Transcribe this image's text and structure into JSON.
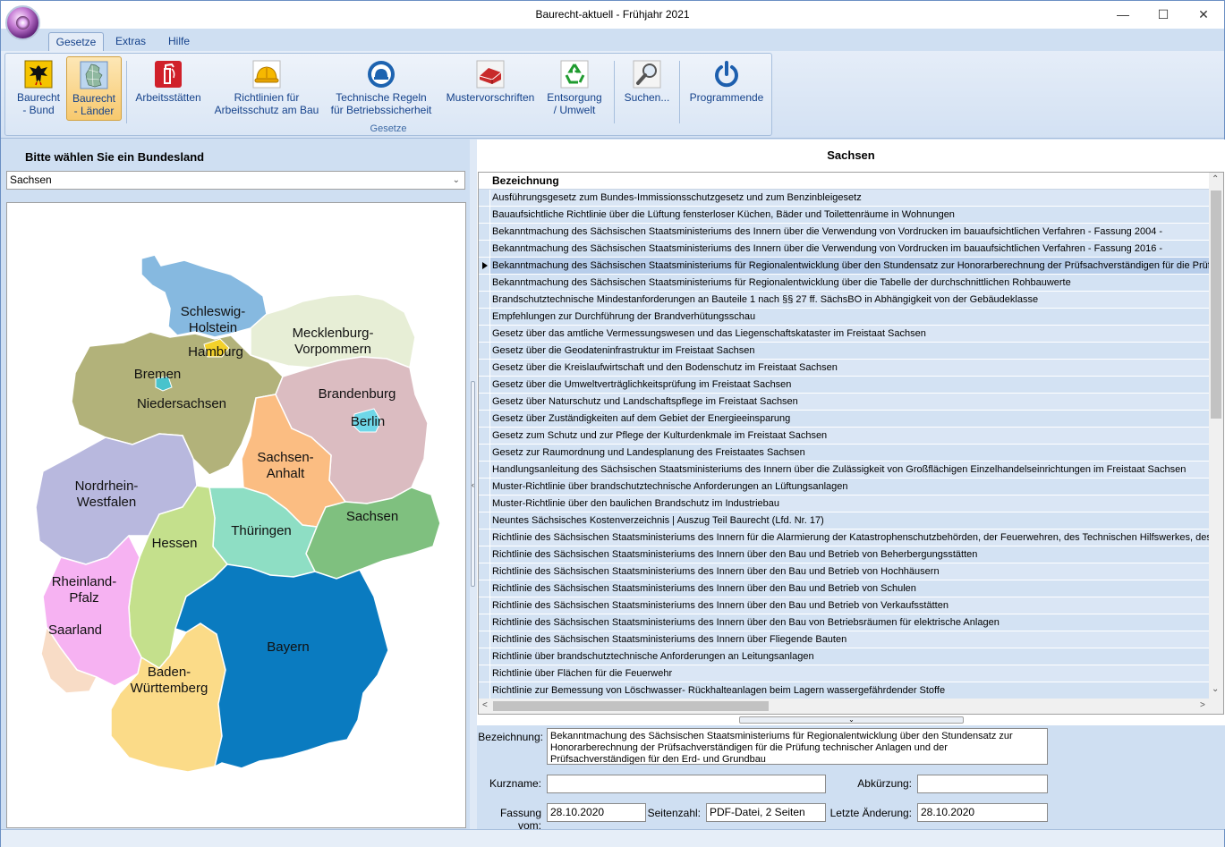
{
  "window": {
    "title": "Baurecht-aktuell - Frühjahr 2021"
  },
  "tabs": [
    "Gesetze",
    "Extras",
    "Hilfe"
  ],
  "ribbon": {
    "group_label": "Gesetze",
    "buttons": [
      {
        "line1": "Baurecht",
        "line2": "- Bund"
      },
      {
        "line1": "Baurecht",
        "line2": "- Länder"
      },
      {
        "line1": "Arbeitsstätten",
        "line2": ""
      },
      {
        "line1": "Richtlinien für",
        "line2": "Arbeitsschutz am Bau"
      },
      {
        "line1": "Technische Regeln",
        "line2": "für Betriebssicherheit"
      },
      {
        "line1": "Mustervorschriften",
        "line2": ""
      },
      {
        "line1": "Entsorgung",
        "line2": "/ Umwelt"
      },
      {
        "line1": "Suchen...",
        "line2": ""
      },
      {
        "line1": "Programmende",
        "line2": ""
      }
    ]
  },
  "left": {
    "heading": "Bitte wählen Sie ein Bundesland",
    "selected_state": "Sachsen",
    "map_labels": {
      "sh1": "Schleswig-",
      "sh2": "Holstein",
      "hh": "Hamburg",
      "mv1": "Mecklenburg-",
      "mv2": "Vorpommern",
      "hb": "Bremen",
      "ni": "Niedersachsen",
      "bb": "Brandenburg",
      "be": "Berlin",
      "st1": "Sachsen-",
      "st2": "Anhalt",
      "nw1": "Nordrhein-",
      "nw2": "Westfalen",
      "sn": "Sachsen",
      "th": "Thüringen",
      "he": "Hessen",
      "rp1": "Rheinland-",
      "rp2": "Pfalz",
      "sl": "Saarland",
      "by": "Bayern",
      "bw1": "Baden-",
      "bw2": "Württemberg"
    }
  },
  "right": {
    "title": "Sachsen",
    "column_header": "Bezeichnung",
    "rows": [
      "Ausführungsgesetz zum Bundes-Immissionsschutzgesetz und zum Benzinbleigesetz",
      "Bauaufsichtliche Richtlinie über die Lüftung fensterloser Küchen, Bäder und Toilettenräume in Wohnungen",
      "Bekanntmachung des Sächsischen Staatsministeriums des Innern über die Verwendung von Vordrucken im bauaufsichtlichen Verfahren - Fassung 2004 -",
      "Bekanntmachung des Sächsischen Staatsministeriums des Innern über die Verwendung von Vordrucken im bauaufsichtlichen Verfahren - Fassung 2016 -",
      "Bekanntmachung des Sächsischen Staatsministeriums für Regionalentwicklung über den Stundensatz zur Honorarberechnung der Prüfsachverständigen für die Prüfung te",
      "Bekanntmachung des Sächsischen Staatsministeriums für Regionalentwicklung über die Tabelle der durchschnittlichen Rohbauwerte",
      "Brandschutztechnische Mindestanforderungen an Bauteile 1 nach §§ 27 ff. SächsBO in Abhängigkeit von der Gebäudeklasse",
      "Empfehlungen zur Durchführung der Brandverhütungsschau",
      "Gesetz über das amtliche Vermessungswesen und das Liegenschaftskataster im Freistaat Sachsen",
      "Gesetz über die Geodateninfrastruktur im Freistaat Sachsen",
      "Gesetz über die Kreislaufwirtschaft und den Bodenschutz im Freistaat Sachsen",
      "Gesetz über die Umweltverträglichkeitsprüfung im Freistaat Sachsen",
      "Gesetz über Naturschutz und Landschaftspflege im Freistaat Sachsen",
      "Gesetz über Zuständigkeiten auf dem Gebiet der Energieeinsparung",
      "Gesetz zum Schutz und zur Pflege der Kulturdenkmale im Freistaat Sachsen",
      "Gesetz zur Raumordnung und Landesplanung des Freistaates Sachsen",
      "Handlungsanleitung des Sächsischen Staatsministeriums des Innern über die Zulässigkeit von Großflächigen Einzelhandelseinrichtungen im Freistaat Sachsen",
      "Muster-Richtlinie über brandschutztechnische Anforderungen an Lüftungsanlagen",
      "Muster-Richtlinie über den baulichen Brandschutz im Industriebau",
      "Neuntes Sächsisches Kostenverzeichnis | Auszug Teil Baurecht (Lfd. Nr. 17)",
      "Richtlinie des Sächsischen Staatsministeriums des Innern für die Alarmierung der Katastrophenschutzbehörden, der Feuerwehren, des Technischen Hilfswerkes, des Rettu",
      "Richtlinie des Sächsischen Staatsministeriums des Innern über den Bau und Betrieb von Beherbergungsstätten",
      "Richtlinie des Sächsischen Staatsministeriums des Innern über den Bau und Betrieb von Hochhäusern",
      "Richtlinie des Sächsischen Staatsministeriums des Innern über den Bau und Betrieb von Schulen",
      "Richtlinie des Sächsischen Staatsministeriums des Innern über den Bau und Betrieb von Verkaufsstätten",
      "Richtlinie des Sächsischen Staatsministeriums des Innern über den Bau von Betriebsräumen für elektrische Anlagen",
      "Richtlinie des Sächsischen Staatsministeriums des Innern über Fliegende Bauten",
      "Richtlinie über brandschutztechnische Anforderungen an Leitungsanlagen",
      "Richtlinie über Flächen für die Feuerwehr",
      "Richtlinie zur Bemessung von Löschwasser- Rückhalteanlagen beim Lagern wassergefährdender Stoffe"
    ],
    "selected_row": 4,
    "form": {
      "bezeichnung_label": "Bezeichnung:",
      "bezeichnung_value": "Bekanntmachung des Sächsischen Staatsministeriums für Regionalentwicklung über den Stundensatz zur Honorarberechnung der Prüfsachverständigen für die Prüfung technischer Anlagen und der Prüfsachverständigen für den Erd- und Grundbau",
      "kurzname_label": "Kurzname:",
      "kurzname_value": "",
      "abkuerzung_label": "Abkürzung:",
      "abkuerzung_value": "",
      "fassung_label": "Fassung vom:",
      "fassung_value": "28.10.2020",
      "seitenzahl_label": "Seitenzahl:",
      "seitenzahl_value": "PDF-Datei, 2 Seiten",
      "letzte_label": "Letzte Änderung:",
      "letzte_value": "28.10.2020"
    }
  },
  "colors": {
    "ribbon_text": "#15428b",
    "selected_row": "#b7cdea",
    "row_bg": "#dae6f5"
  }
}
